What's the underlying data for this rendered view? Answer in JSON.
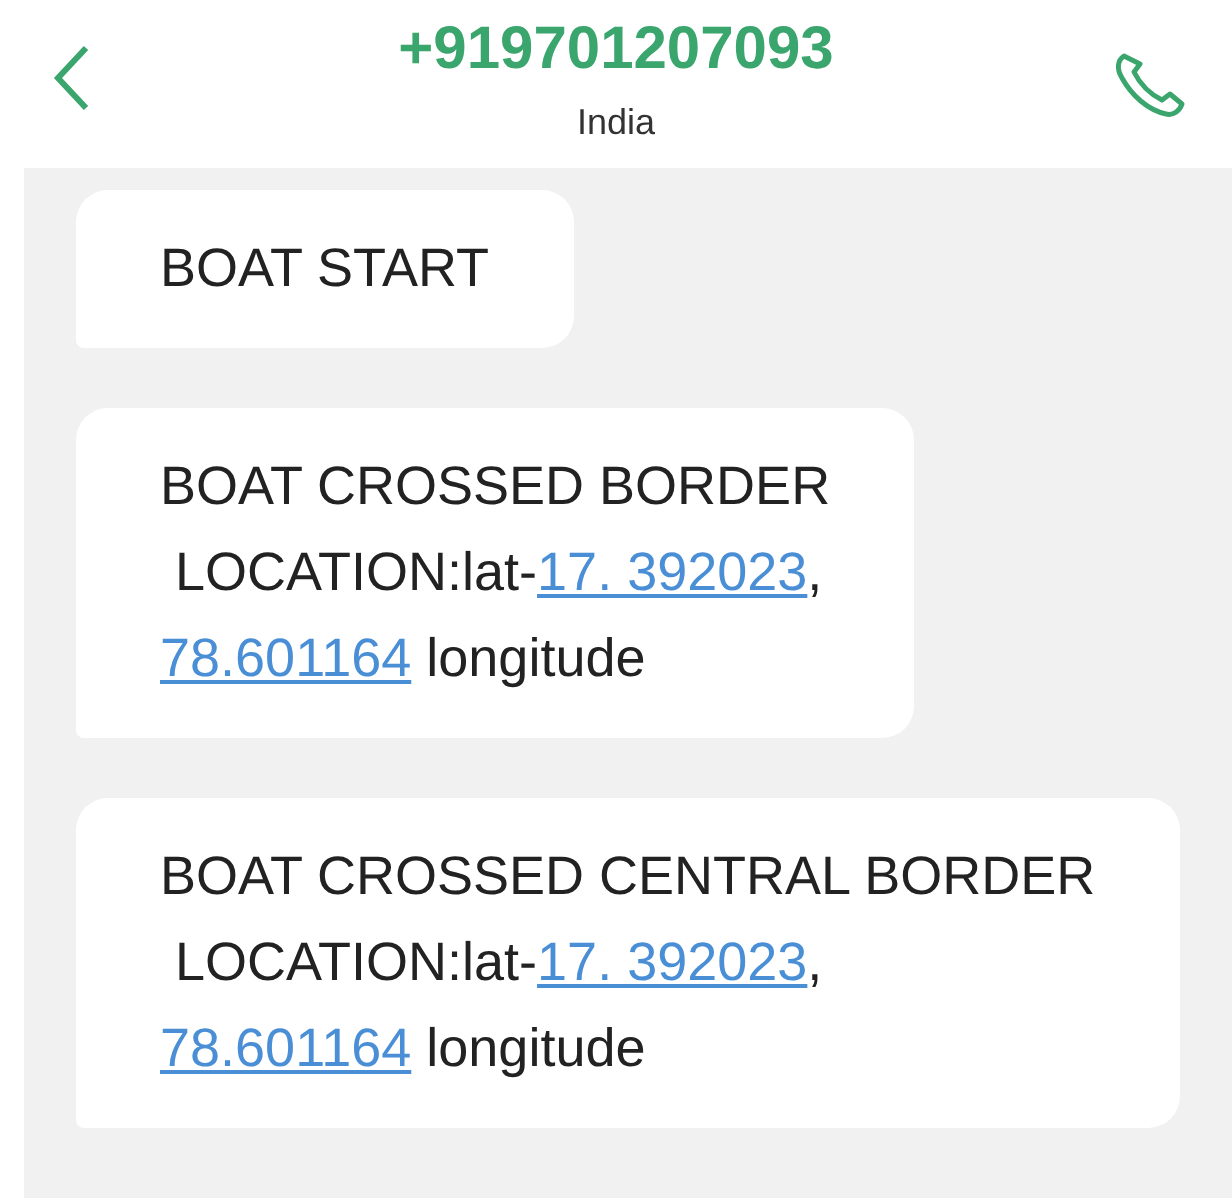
{
  "header": {
    "title": "+919701207093",
    "subtitle": "India"
  },
  "messages": [
    {
      "lines": [
        [
          {
            "kind": "text",
            "text": "BOAT START"
          }
        ]
      ]
    },
    {
      "lines": [
        [
          {
            "kind": "text",
            "text": "BOAT CROSSED BORDER"
          }
        ],
        [
          {
            "kind": "text",
            "text": " LOCATION:lat-"
          },
          {
            "kind": "link",
            "text": "17. 392023"
          },
          {
            "kind": "text",
            "text": ","
          }
        ],
        [
          {
            "kind": "link",
            "text": "78.601164"
          },
          {
            "kind": "text",
            "text": " longitude"
          }
        ]
      ]
    },
    {
      "lines": [
        [
          {
            "kind": "text",
            "text": "BOAT CROSSED CENTRAL BORDER"
          }
        ],
        [
          {
            "kind": "text",
            "text": " LOCATION:lat-"
          },
          {
            "kind": "link",
            "text": "17. 392023"
          },
          {
            "kind": "text",
            "text": ","
          }
        ],
        [
          {
            "kind": "link",
            "text": "78.601164"
          },
          {
            "kind": "text",
            "text": " longitude"
          }
        ]
      ]
    }
  ]
}
